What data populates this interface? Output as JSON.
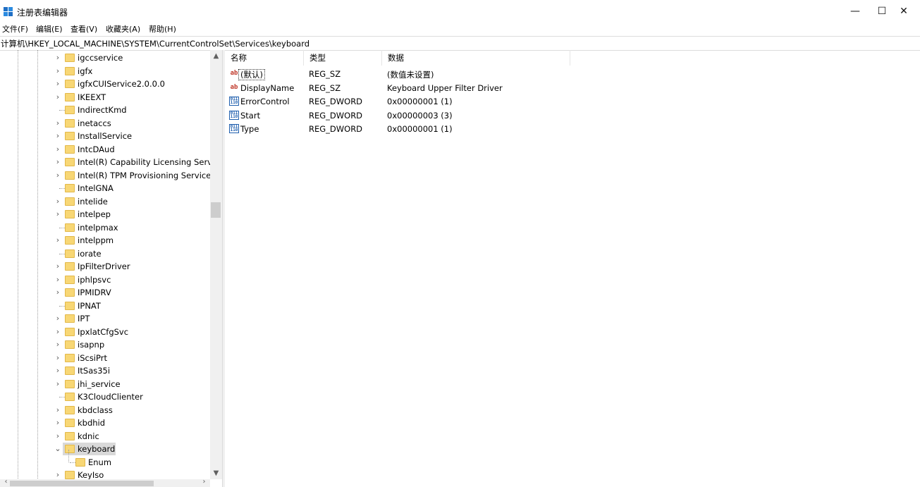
{
  "window": {
    "title": "注册表编辑器",
    "minimize": "—",
    "maximize": "☐",
    "close": "✕"
  },
  "menu": [
    "文件(F)",
    "编辑(E)",
    "查看(V)",
    "收藏夹(A)",
    "帮助(H)"
  ],
  "address": "计算机\\HKEY_LOCAL_MACHINE\\SYSTEM\\CurrentControlSet\\Services\\keyboard",
  "tree": {
    "items": [
      {
        "label": "igccservice",
        "expandable": true
      },
      {
        "label": "igfx",
        "expandable": true
      },
      {
        "label": "igfxCUIService2.0.0.0",
        "expandable": true
      },
      {
        "label": "IKEEXT",
        "expandable": true
      },
      {
        "label": "IndirectKmd",
        "expandable": false
      },
      {
        "label": "inetaccs",
        "expandable": true
      },
      {
        "label": "InstallService",
        "expandable": true
      },
      {
        "label": "IntcDAud",
        "expandable": true
      },
      {
        "label": "Intel(R) Capability Licensing Service",
        "expandable": true
      },
      {
        "label": "Intel(R) TPM Provisioning Service",
        "expandable": true
      },
      {
        "label": "IntelGNA",
        "expandable": false
      },
      {
        "label": "intelide",
        "expandable": true
      },
      {
        "label": "intelpep",
        "expandable": true
      },
      {
        "label": "intelpmax",
        "expandable": false
      },
      {
        "label": "intelppm",
        "expandable": true
      },
      {
        "label": "iorate",
        "expandable": false
      },
      {
        "label": "IpFilterDriver",
        "expandable": true
      },
      {
        "label": "iphlpsvc",
        "expandable": true
      },
      {
        "label": "IPMIDRV",
        "expandable": true
      },
      {
        "label": "IPNAT",
        "expandable": false
      },
      {
        "label": "IPT",
        "expandable": true
      },
      {
        "label": "IpxlatCfgSvc",
        "expandable": true
      },
      {
        "label": "isapnp",
        "expandable": true
      },
      {
        "label": "iScsiPrt",
        "expandable": true
      },
      {
        "label": "ItSas35i",
        "expandable": true
      },
      {
        "label": "jhi_service",
        "expandable": true
      },
      {
        "label": "K3CloudClienter",
        "expandable": false
      },
      {
        "label": "kbdclass",
        "expandable": true
      },
      {
        "label": "kbdhid",
        "expandable": true
      },
      {
        "label": "kdnic",
        "expandable": true
      },
      {
        "label": "keyboard",
        "expandable": true,
        "expanded": true,
        "selected": true
      },
      {
        "label": "Enum",
        "expandable": false,
        "child": true
      },
      {
        "label": "KeyIso",
        "expandable": true
      }
    ]
  },
  "values": {
    "columns": [
      "名称",
      "类型",
      "数据"
    ],
    "rows": [
      {
        "icon": "string-value-icon",
        "name": "(默认)",
        "type": "REG_SZ",
        "data": "(数值未设置)"
      },
      {
        "icon": "string-value-icon",
        "name": "DisplayName",
        "type": "REG_SZ",
        "data": "Keyboard Upper Filter Driver"
      },
      {
        "icon": "dword-value-icon",
        "name": "ErrorControl",
        "type": "REG_DWORD",
        "data": "0x00000001 (1)"
      },
      {
        "icon": "dword-value-icon",
        "name": "Start",
        "type": "REG_DWORD",
        "data": "0x00000003 (3)"
      },
      {
        "icon": "dword-value-icon",
        "name": "Type",
        "type": "REG_DWORD",
        "data": "0x00000001 (1)"
      }
    ]
  }
}
